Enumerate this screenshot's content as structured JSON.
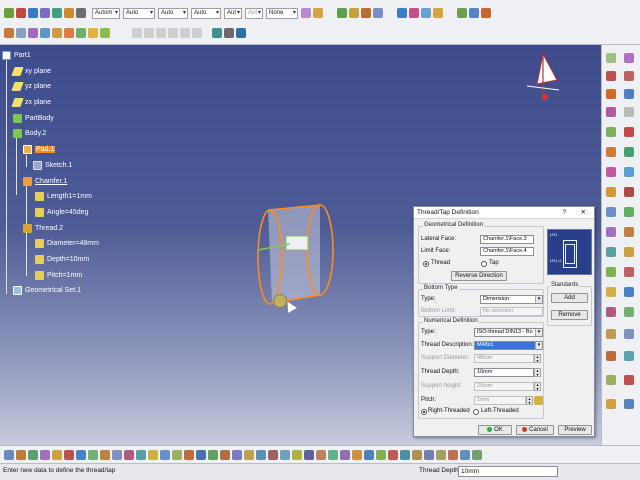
{
  "toolbar": {
    "selects": [
      {
        "value": "Autom"
      },
      {
        "value": "Auto"
      },
      {
        "value": "Auto"
      },
      {
        "value": "Auto"
      },
      {
        "value": "Aut"
      },
      {
        "value": "Aut"
      },
      {
        "value": "None"
      }
    ]
  },
  "tree": {
    "root": "Part1",
    "items": [
      {
        "label": "xy plane"
      },
      {
        "label": "yz plane"
      },
      {
        "label": "zx plane"
      },
      {
        "label": "PartBody"
      },
      {
        "label": "Body.2"
      },
      {
        "label": "Pad.1"
      },
      {
        "label": "Sketch.1"
      },
      {
        "label": "Chamfer.1"
      },
      {
        "label": "Length1=1mm"
      },
      {
        "label": "Angle=45deg"
      },
      {
        "label": "Thread.2"
      },
      {
        "label": "Diameter=48mm"
      },
      {
        "label": "Depth=10mm"
      },
      {
        "label": "Pitch=1mm"
      },
      {
        "label": "Geometrical Set.1"
      }
    ]
  },
  "dialog": {
    "title": "Thread/Tap Definition",
    "help": "?",
    "close": "✕",
    "geometrical": {
      "group": "Geometrical Definition",
      "lateral_label": "Lateral Face:",
      "lateral_value": "Chamfer.1\\Face.3",
      "limit_label": "Limit Face:",
      "limit_value": "Chamfer.1\\Face.4",
      "thread": "Thread",
      "tap": "Tap",
      "reverse": "Reverse Direction",
      "diagram_labels": [
        "LR1",
        "LR1-4"
      ]
    },
    "bottom": {
      "group": "Bottom Type",
      "type_label": "Type:",
      "type_value": "Dimension",
      "limit_label": "Bottom Limit:",
      "limit_value": "No selection"
    },
    "standards": {
      "group": "Standards",
      "add": "Add",
      "remove": "Remove"
    },
    "numerical": {
      "group": "Numerical Definition",
      "type_label": "Type:",
      "type_value": "ISO-thread DIN13 - Bo",
      "desc_label": "Thread Description:",
      "desc_value": "M48x1",
      "support_diam_label": "Support Diameter:",
      "support_diam_value": "48mm",
      "depth_label": "Thread Depth:",
      "depth_value": "10mm",
      "support_height_label": "Support height:",
      "support_height_value": "20mm",
      "pitch_label": "Pitch:",
      "pitch_value": "1mm",
      "right": "Right-Threaded",
      "left": "Left-Threaded"
    },
    "ok": "OK",
    "cancel": "Cancel",
    "preview": "Preview"
  },
  "status": {
    "message": "Enter new data to define the thread/tap",
    "field_label": "Thread Depth",
    "field_value": "10mm"
  },
  "colors": {
    "selection": "#ff8c1a",
    "viewport_top": "#3e4c8c",
    "highlight": "#3875d7"
  }
}
